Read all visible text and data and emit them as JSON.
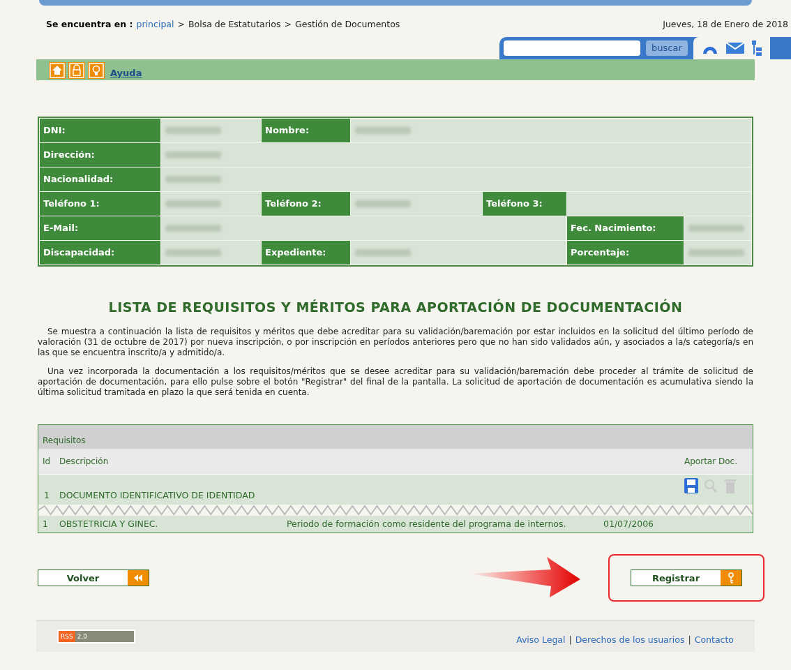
{
  "breadcrumb": {
    "label": "Se encuentra en :",
    "items": [
      {
        "text": "principal",
        "kind": "link"
      },
      {
        "text": "Bolsa de Estatutarios",
        "kind": "text"
      },
      {
        "text": "Gestión de Documentos",
        "kind": "text"
      }
    ],
    "separator": ">"
  },
  "date": "Jueves, 18 de Enero de 2018",
  "search": {
    "button": "buscar"
  },
  "help_link": "Ayuda",
  "personal_data": [
    [
      {
        "kind": "label",
        "text": "DNI:"
      },
      {
        "kind": "value",
        "blurred": true
      },
      {
        "kind": "label",
        "text": "Nombre:"
      },
      {
        "kind": "value",
        "blurred": true
      }
    ],
    [
      {
        "kind": "label",
        "text": "Dirección:"
      },
      {
        "kind": "value",
        "blurred": true
      }
    ],
    [
      {
        "kind": "label",
        "text": "Nacionalidad:"
      },
      {
        "kind": "value",
        "blurred": true
      }
    ],
    [
      {
        "kind": "label",
        "text": "Teléfono 1:"
      },
      {
        "kind": "value",
        "blurred": true
      },
      {
        "kind": "label",
        "text": "Teléfono 2:"
      },
      {
        "kind": "value",
        "blurred": true
      },
      {
        "kind": "label",
        "text": "Teléfono 3:"
      },
      {
        "kind": "value",
        "blurred": false
      }
    ],
    [
      {
        "kind": "label",
        "text": "E-Mail:"
      },
      {
        "kind": "value",
        "blurred": true
      },
      {
        "kind": "label",
        "text": "Fec. Nacimiento:"
      },
      {
        "kind": "value",
        "blurred": true
      }
    ],
    [
      {
        "kind": "label",
        "text": "Discapacidad:"
      },
      {
        "kind": "value",
        "blurred": true
      },
      {
        "kind": "label",
        "text": "Expediente:"
      },
      {
        "kind": "value",
        "blurred": true
      },
      {
        "kind": "label",
        "text": "Porcentaje:"
      },
      {
        "kind": "value",
        "blurred": true
      }
    ]
  ],
  "heading": "LISTA DE REQUISITOS Y MÉRITOS PARA APORTACIÓN DE DOCUMENTACIÓN",
  "paragraphs": [
    "Se muestra a continuación la lista de requisitos y méritos que debe acreditar para su validación/baremación por estar incluidos en la solicitud del último período de valoración (31 de octubre de 2017) por nueva inscripción, o por inscripción en períodos anteriores pero que no han sido validados aún, y asociados a la/s categoría/s en las que se encuentra inscrito/a y admitido/a.",
    "Una vez incorporada la documentación a los requisitos/méritos que se desee acreditar para su validación/baremación debe proceder al trámite de solicitud de aportación de documentación, para ello pulse sobre el botón \"Registrar\" del final de la pantalla. La solicitud de aportación de documentación es acumulativa siendo la última solicitud tramitada en plazo la que será tenida en cuenta."
  ],
  "table": {
    "title": "Requisitos",
    "columns": [
      "Id",
      "Descripción",
      "Aportar Doc."
    ],
    "rows": [
      {
        "id": "1",
        "description": "DOCUMENTO IDENTIFICATIVO DE IDENTIDAD",
        "actions": [
          {
            "kind": "save",
            "disabled": false
          },
          {
            "kind": "view",
            "disabled": true
          },
          {
            "kind": "delete",
            "disabled": true
          }
        ]
      }
    ],
    "rows_after_cut": [
      {
        "cells": [
          "1",
          "OBSTETRICIA Y GINEC.",
          "Periodo de formación como residente del programa de internos.",
          "01/07/2006"
        ]
      }
    ]
  },
  "buttons": [
    {
      "text": "Volver",
      "kind": "back"
    },
    {
      "text": "Registrar",
      "kind": "key",
      "highlighted": true
    }
  ],
  "footer": {
    "rss": [
      "RSS",
      "2.0"
    ],
    "links": [
      "Aviso Legal",
      "Derechos de los usuarios",
      "Contacto"
    ],
    "separator": "|"
  }
}
